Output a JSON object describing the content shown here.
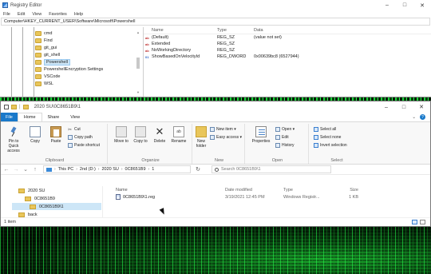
{
  "regedit": {
    "title": "Registry Editor",
    "window_controls": [
      "–",
      "□",
      "✕"
    ],
    "menu": [
      "File",
      "Edit",
      "View",
      "Favorites",
      "Help"
    ],
    "address": "Computer\\HKEY_CURRENT_USER\\Software\\Microsoft\\Powershell",
    "tree": [
      {
        "label": "cmd",
        "selected": false
      },
      {
        "label": "Find",
        "selected": false
      },
      {
        "label": "git_gui",
        "selected": false
      },
      {
        "label": "git_shell",
        "selected": false
      },
      {
        "label": "Powershell",
        "selected": true
      },
      {
        "label": "PowershellEncryption Settings",
        "selected": false
      },
      {
        "label": "VSCode",
        "selected": false
      },
      {
        "label": "WSL",
        "selected": false
      }
    ],
    "columns": {
      "name": "Name",
      "type": "Type",
      "data": "Data"
    },
    "values": [
      {
        "icon": "string",
        "name": "(Default)",
        "type": "REG_SZ",
        "data": "(value not set)"
      },
      {
        "icon": "string",
        "name": "Extended",
        "type": "REG_SZ",
        "data": ""
      },
      {
        "icon": "string",
        "name": "NoWorkingDirectory",
        "type": "REG_SZ",
        "data": ""
      },
      {
        "icon": "dword",
        "name": "ShowBasedOnVelocityId",
        "type": "REG_DWORD",
        "data": "0x00639bc8 (6527944)"
      }
    ]
  },
  "explorer": {
    "title": "2020 SU\\0C8651B9\\1",
    "window_controls": [
      "–",
      "□",
      "✕"
    ],
    "tabs": [
      "File",
      "Home",
      "Share",
      "View"
    ],
    "active_tab": "Home",
    "ribbon": {
      "pin_label": "Pin to Quick access",
      "copy_label": "Copy",
      "paste_label": "Paste",
      "cut_label": "Cut",
      "copy_path_label": "Copy path",
      "paste_shortcut_label": "Paste shortcut",
      "clipboard_group": "Clipboard",
      "move_to_label": "Move to",
      "copy_to_label": "Copy to",
      "delete_label": "Delete",
      "rename_label": "Rename",
      "organize_group": "Organize",
      "new_item_label": "New item ▾",
      "easy_access_label": "Easy access ▾",
      "new_folder_label": "New folder",
      "new_group": "New",
      "properties_label": "Properties",
      "open_label": "Open ▾",
      "edit_label": "Edit",
      "history_label": "History",
      "open_group": "Open",
      "select_all_label": "Select all",
      "select_none_label": "Select none",
      "invert_selection_label": "Invert selection",
      "select_group": "Select"
    },
    "breadcrumb": [
      "This PC",
      "2nd (D:)",
      "2020 SU",
      "0C8651B9",
      "1"
    ],
    "search_placeholder": "Search 0C8651B9\\1",
    "nav": [
      {
        "label": "2020 SU",
        "selected": false
      },
      {
        "label": "0C8651B9",
        "selected": false
      },
      {
        "label": "0C8651B9\\1",
        "selected": true
      },
      {
        "label": "back",
        "selected": false
      }
    ],
    "columns": {
      "name": "Name",
      "date": "Date modified",
      "type": "Type",
      "size": "Size"
    },
    "files": [
      {
        "name": "0C8651B9\\1.reg",
        "date": "3/19/2021 12:45 PM",
        "type": "Windows Registr...",
        "size": "1 KB"
      }
    ],
    "status": "1 item"
  }
}
